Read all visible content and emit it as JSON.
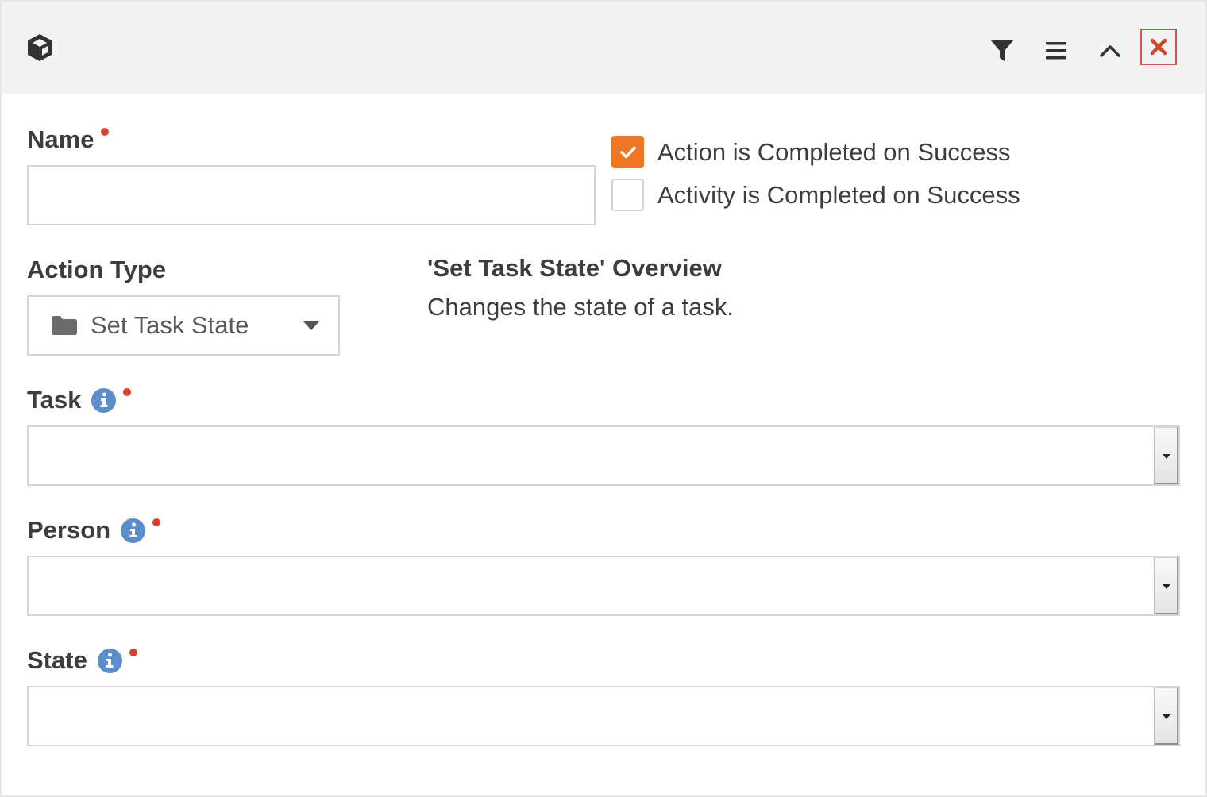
{
  "header": {
    "icons": {
      "app": "cube-icon",
      "filter": "filter-icon",
      "menu": "menu-icon",
      "collapse": "chevron-up-icon",
      "close": "close-icon"
    }
  },
  "form": {
    "name": {
      "label": "Name",
      "value": "",
      "required": true
    },
    "options": [
      {
        "label": "Action is Completed on Success",
        "checked": true
      },
      {
        "label": "Activity is Completed on Success",
        "checked": false
      }
    ],
    "action_type": {
      "label": "Action Type",
      "selected": "Set Task State",
      "icon": "folder-icon"
    },
    "overview": {
      "title": "'Set Task State' Overview",
      "description": "Changes the state of a task."
    },
    "task": {
      "label": "Task",
      "value": "",
      "required": true
    },
    "person": {
      "label": "Person",
      "value": "",
      "required": true
    },
    "state": {
      "label": "State",
      "value": "",
      "required": true
    }
  },
  "colors": {
    "accent_orange": "#ee7625",
    "required_red": "#d9442f",
    "info_blue": "#5b8ccc",
    "close_red": "#d9534f",
    "header_bg": "#f3f3f3"
  }
}
